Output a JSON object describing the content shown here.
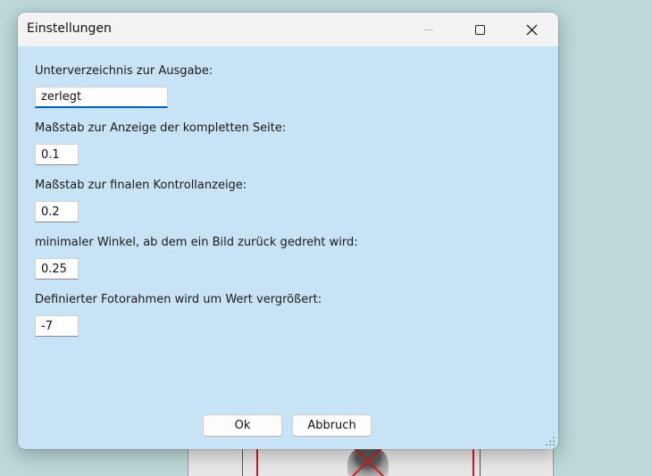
{
  "window": {
    "title": "Einstellungen"
  },
  "fields": [
    {
      "label": "Unterverzeichnis zur Ausgabe:",
      "value": "zerlegt"
    },
    {
      "label": "Maßstab zur Anzeige der kompletten Seite:",
      "value": "0.1"
    },
    {
      "label": "Maßstab zur finalen Kontrollanzeige:",
      "value": "0.2"
    },
    {
      "label": "minimaler Winkel, ab dem ein Bild zurück gedreht wird:",
      "value": "0.25"
    },
    {
      "label": "Definierter Fotorahmen wird um Wert vergrößert:",
      "value": "-7"
    }
  ],
  "buttons": {
    "ok": "Ok",
    "cancel": "Abbruch"
  },
  "icons": {
    "minimize": "minimize-icon",
    "maximize": "maximize-icon",
    "close": "close-icon",
    "resize": "resize-grip-icon"
  },
  "colors": {
    "dialog_background": "#c7e3f5",
    "titlebar": "#f3f3f3",
    "focus_accent": "#005fb8"
  }
}
